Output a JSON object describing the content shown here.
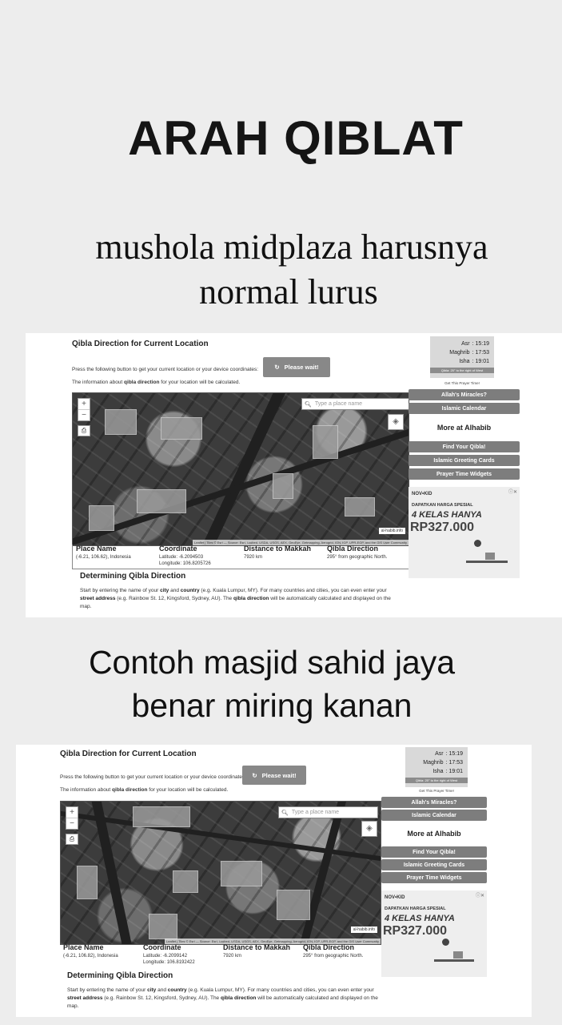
{
  "title": "ARAH QIBLAT",
  "caption1": [
    "mushola midplaza harusnya",
    "normal lurus"
  ],
  "caption2": [
    "Contoh masjid sahid jaya",
    "benar miring kanan"
  ],
  "screens": [
    {
      "heading": "Qibla Direction for Current Location",
      "instruction": "Press the following button to get your current location or your device coordinates:",
      "info_pre": "The information about ",
      "info_bold": "qibla direction",
      "info_post": " for your location will be calculated.",
      "wait_button": "Please wait!",
      "search_placeholder": "Type a place name",
      "attribution": "Leaflet | Tiles © Esri — Source: Esri, i-cubed, USDA, USGS, AEX, GeoEye, Getmapping, Aerogrid, IGN, IGP, UPR-EGP, and the GIS User Community",
      "site_tag": "al-habib.info",
      "place_header": "Place Name",
      "place_value": "(-6.21, 106.62), Indonesia",
      "coord_header": "Coordinate",
      "latitude": "Latitude: -6.2094503",
      "longitude": "Longitude: 106.8205726",
      "dist_header": "Distance to Makkah",
      "dist_value": "7920 km",
      "qibla_header": "Qibla Direction",
      "qibla_value": "295° from geographic North.",
      "determining_header": "Determining Qibla Direction",
      "para1_a": "Start by entering the name of your ",
      "para1_b": "city",
      "para1_c": " and ",
      "para1_d": "country",
      "para1_e": " (e.g. Kuala Lumpur, MY). For many countries and cities, you can even enter your",
      "para2_a": "street address",
      "para2_b": " (e.g. Rainbow St. 12, Kingsford, Sydney, AU). The ",
      "para2_c": "qibla direction",
      "para2_d": " will be automatically calculated and displayed on the",
      "para3": "map.",
      "prayer": [
        {
          "name": "Asr",
          "time": ": 15:19"
        },
        {
          "name": "Maghrib",
          "time": ": 17:53"
        },
        {
          "name": "Isha",
          "time": ": 19:01"
        }
      ],
      "prayer_note": "Qibla: 25° to the right of West",
      "get_prayer": "Get This Prayer Time!",
      "btn_miracles": "Allah's Miracles?",
      "btn_calendar": "Islamic Calendar",
      "more_header": "More at Alhabib",
      "btn_find": "Find Your Qibla!",
      "btn_greeting": "Islamic Greeting Cards",
      "btn_widgets": "Prayer Time Widgets",
      "ad_logo": "NOV•KID",
      "ad_line1": "DAPATKAN HARGA SPESIAL",
      "ad_line2": "4 KELAS HANYA",
      "ad_price": "RP327.000",
      "ad_close": "ⓘ✕"
    },
    {
      "heading": "Qibla Direction for Current Location",
      "instruction": "Press the following button to get your current location or your device coordinates:",
      "info_pre": "The information about ",
      "info_bold": "qibla direction",
      "info_post": " for your location will be calculated.",
      "wait_button": "Please wait!",
      "search_placeholder": "Type a place name",
      "attribution": "Leaflet | Tiles © Esri — Source: Esri, i-cubed, USDA, USGS, AEX, GeoEye, Getmapping, Aerogrid, IGN, IGP, UPR-EGP, and the GIS User Community",
      "site_tag": "al-habib.info",
      "place_header": "Place Name",
      "place_value": "(-6.21, 106.82), Indonesia",
      "coord_header": "Coordinate",
      "latitude": "Latitude: -6.2099142",
      "longitude": "Longitude: 106.8192422",
      "dist_header": "Distance to Makkah",
      "dist_value": "7920 km",
      "qibla_header": "Qibla Direction",
      "qibla_value": "295° from geographic North.",
      "determining_header": "Determining Qibla Direction",
      "para1_a": "Start by entering the name of your ",
      "para1_b": "city",
      "para1_c": " and ",
      "para1_d": "country",
      "para1_e": " (e.g. Kuala Lumpur, MY). For many countries and cities, you can even enter your",
      "para2_a": "street address",
      "para2_b": " (e.g. Rainbow St. 12, Kingsford, Sydney, AU). The ",
      "para2_c": "qibla direction",
      "para2_d": " will be automatically calculated and displayed on the",
      "para3": "map.",
      "prayer": [
        {
          "name": "Asr",
          "time": ": 15:19"
        },
        {
          "name": "Maghrib",
          "time": ": 17:53"
        },
        {
          "name": "Isha",
          "time": ": 19:01"
        }
      ],
      "prayer_note": "Qibla: 25° to the right of West",
      "get_prayer": "Get This Prayer Time!",
      "btn_miracles": "Allah's Miracles?",
      "btn_calendar": "Islamic Calendar",
      "more_header": "More at Alhabib",
      "btn_find": "Find Your Qibla!",
      "btn_greeting": "Islamic Greeting Cards",
      "btn_widgets": "Prayer Time Widgets",
      "ad_logo": "NOV•KID",
      "ad_line1": "DAPATKAN HARGA SPESIAL",
      "ad_line2": "4 KELAS HANYA",
      "ad_price": "RP327.000",
      "ad_close": "ⓘ✕"
    }
  ]
}
